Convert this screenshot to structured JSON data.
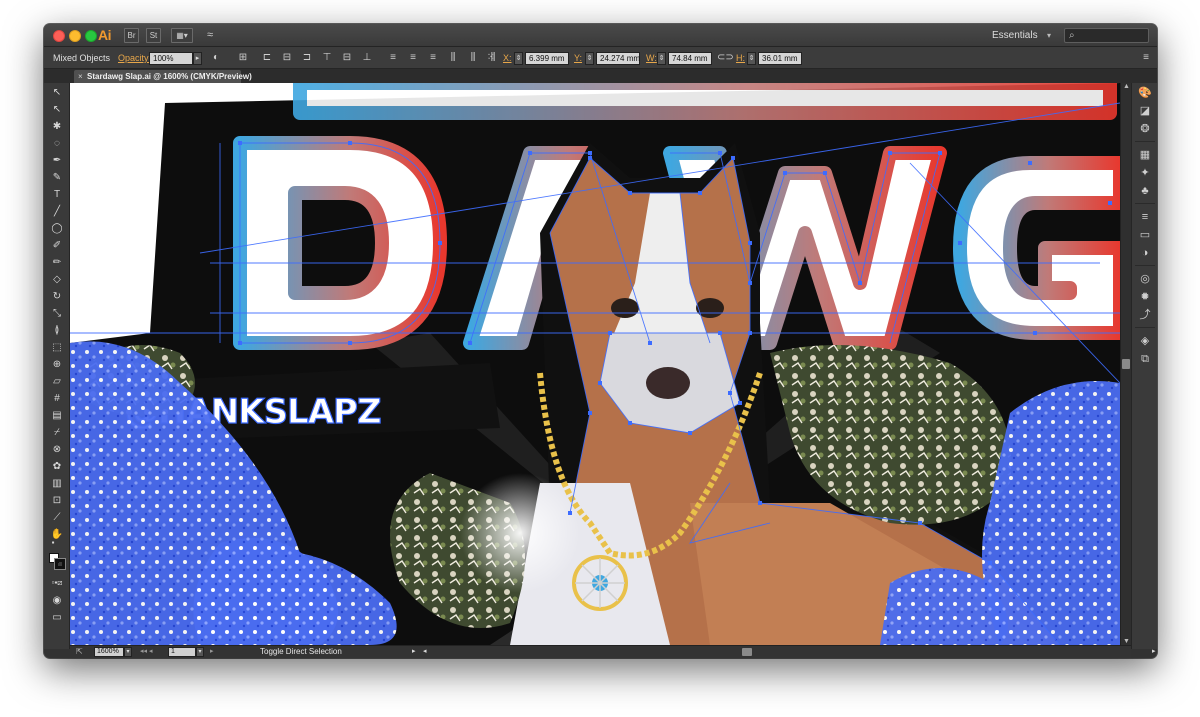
{
  "app": {
    "logo": "Ai",
    "bridge_btn": "Br",
    "stock_btn": "St",
    "arrange_btn": "▦▾",
    "gpu_btn": "≈",
    "workspace": "Essentials",
    "workspace_caret": "▾",
    "search_icon": "⌕"
  },
  "control_bar": {
    "selection_type": "Mixed Objects",
    "opacity_label": "Opacity:",
    "opacity_value": "100%",
    "x_label": "X:",
    "x_value": "6.399 mm",
    "y_label": "Y:",
    "y_value": "24.274 mm",
    "w_label": "W:",
    "w_value": "74.84 mm",
    "h_label": "H:",
    "h_value": "36.01 mm",
    "panel_menu": "≡"
  },
  "document": {
    "tab_close": "×",
    "tab_title": "Stardawg Slap.ai @ 1600% (CMYK/Preview)"
  },
  "artwork": {
    "title_text": "DAWG",
    "handle_text": "@HANKSLAPZ"
  },
  "status_bar": {
    "zoom": "1600%",
    "page": "1",
    "status_text": "Toggle Direct Selection",
    "prev_page": "◂◂ ◂",
    "next_page": "▸"
  },
  "colors": {
    "app_bg": "#323232",
    "accent_label": "#e8a74a",
    "selection_blue": "#3d6cff",
    "gradient_start": "#3fa7e0",
    "gradient_end": "#e8382e"
  },
  "icons": {
    "tools": [
      "selection-arrow",
      "direct-selection-arrow",
      "magic-wand",
      "lasso",
      "pen",
      "curvature",
      "type",
      "line-segment",
      "rectangle",
      "paintbrush",
      "shaper",
      "eraser",
      "rotate",
      "scale",
      "width",
      "free-transform",
      "shape-builder",
      "perspective-grid",
      "mesh",
      "gradient",
      "eyedropper",
      "blend",
      "symbol-sprayer",
      "column-graph",
      "artboard",
      "slice",
      "hand",
      "zoom"
    ],
    "dock": [
      "color-icon",
      "color-guide-icon",
      "cc-libraries-icon",
      "swatches-icon",
      "brushes-icon",
      "symbols-icon",
      "stroke-icon",
      "gradient-icon",
      "transparency-icon",
      "appearance-icon",
      "graphic-styles-icon",
      "asset-export-icon",
      "layers-icon",
      "artboards-icon"
    ]
  }
}
